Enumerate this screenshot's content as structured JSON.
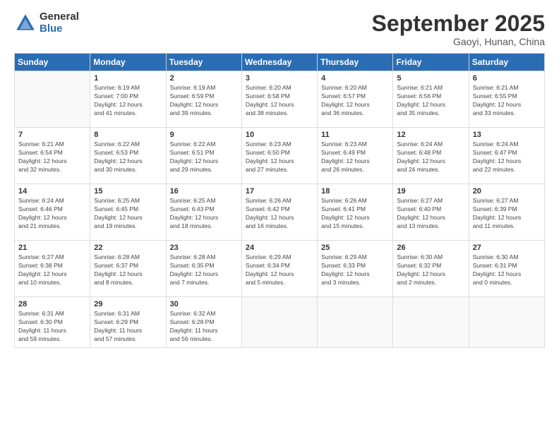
{
  "logo": {
    "general": "General",
    "blue": "Blue"
  },
  "title": "September 2025",
  "subtitle": "Gaoyi, Hunan, China",
  "weekdays": [
    "Sunday",
    "Monday",
    "Tuesday",
    "Wednesday",
    "Thursday",
    "Friday",
    "Saturday"
  ],
  "weeks": [
    [
      {
        "day": "",
        "info": ""
      },
      {
        "day": "1",
        "info": "Sunrise: 6:19 AM\nSunset: 7:00 PM\nDaylight: 12 hours\nand 41 minutes."
      },
      {
        "day": "2",
        "info": "Sunrise: 6:19 AM\nSunset: 6:59 PM\nDaylight: 12 hours\nand 39 minutes."
      },
      {
        "day": "3",
        "info": "Sunrise: 6:20 AM\nSunset: 6:58 PM\nDaylight: 12 hours\nand 38 minutes."
      },
      {
        "day": "4",
        "info": "Sunrise: 6:20 AM\nSunset: 6:57 PM\nDaylight: 12 hours\nand 36 minutes."
      },
      {
        "day": "5",
        "info": "Sunrise: 6:21 AM\nSunset: 6:56 PM\nDaylight: 12 hours\nand 35 minutes."
      },
      {
        "day": "6",
        "info": "Sunrise: 6:21 AM\nSunset: 6:55 PM\nDaylight: 12 hours\nand 33 minutes."
      }
    ],
    [
      {
        "day": "7",
        "info": "Sunrise: 6:21 AM\nSunset: 6:54 PM\nDaylight: 12 hours\nand 32 minutes."
      },
      {
        "day": "8",
        "info": "Sunrise: 6:22 AM\nSunset: 6:53 PM\nDaylight: 12 hours\nand 30 minutes."
      },
      {
        "day": "9",
        "info": "Sunrise: 6:22 AM\nSunset: 6:51 PM\nDaylight: 12 hours\nand 29 minutes."
      },
      {
        "day": "10",
        "info": "Sunrise: 6:23 AM\nSunset: 6:50 PM\nDaylight: 12 hours\nand 27 minutes."
      },
      {
        "day": "11",
        "info": "Sunrise: 6:23 AM\nSunset: 6:49 PM\nDaylight: 12 hours\nand 26 minutes."
      },
      {
        "day": "12",
        "info": "Sunrise: 6:24 AM\nSunset: 6:48 PM\nDaylight: 12 hours\nand 24 minutes."
      },
      {
        "day": "13",
        "info": "Sunrise: 6:24 AM\nSunset: 6:47 PM\nDaylight: 12 hours\nand 22 minutes."
      }
    ],
    [
      {
        "day": "14",
        "info": "Sunrise: 6:24 AM\nSunset: 6:46 PM\nDaylight: 12 hours\nand 21 minutes."
      },
      {
        "day": "15",
        "info": "Sunrise: 6:25 AM\nSunset: 6:45 PM\nDaylight: 12 hours\nand 19 minutes."
      },
      {
        "day": "16",
        "info": "Sunrise: 6:25 AM\nSunset: 6:43 PM\nDaylight: 12 hours\nand 18 minutes."
      },
      {
        "day": "17",
        "info": "Sunrise: 6:26 AM\nSunset: 6:42 PM\nDaylight: 12 hours\nand 16 minutes."
      },
      {
        "day": "18",
        "info": "Sunrise: 6:26 AM\nSunset: 6:41 PM\nDaylight: 12 hours\nand 15 minutes."
      },
      {
        "day": "19",
        "info": "Sunrise: 6:27 AM\nSunset: 6:40 PM\nDaylight: 12 hours\nand 13 minutes."
      },
      {
        "day": "20",
        "info": "Sunrise: 6:27 AM\nSunset: 6:39 PM\nDaylight: 12 hours\nand 11 minutes."
      }
    ],
    [
      {
        "day": "21",
        "info": "Sunrise: 6:27 AM\nSunset: 6:38 PM\nDaylight: 12 hours\nand 10 minutes."
      },
      {
        "day": "22",
        "info": "Sunrise: 6:28 AM\nSunset: 6:37 PM\nDaylight: 12 hours\nand 8 minutes."
      },
      {
        "day": "23",
        "info": "Sunrise: 6:28 AM\nSunset: 6:35 PM\nDaylight: 12 hours\nand 7 minutes."
      },
      {
        "day": "24",
        "info": "Sunrise: 6:29 AM\nSunset: 6:34 PM\nDaylight: 12 hours\nand 5 minutes."
      },
      {
        "day": "25",
        "info": "Sunrise: 6:29 AM\nSunset: 6:33 PM\nDaylight: 12 hours\nand 3 minutes."
      },
      {
        "day": "26",
        "info": "Sunrise: 6:30 AM\nSunset: 6:32 PM\nDaylight: 12 hours\nand 2 minutes."
      },
      {
        "day": "27",
        "info": "Sunrise: 6:30 AM\nSunset: 6:31 PM\nDaylight: 12 hours\nand 0 minutes."
      }
    ],
    [
      {
        "day": "28",
        "info": "Sunrise: 6:31 AM\nSunset: 6:30 PM\nDaylight: 11 hours\nand 59 minutes."
      },
      {
        "day": "29",
        "info": "Sunrise: 6:31 AM\nSunset: 6:29 PM\nDaylight: 11 hours\nand 57 minutes."
      },
      {
        "day": "30",
        "info": "Sunrise: 6:32 AM\nSunset: 6:28 PM\nDaylight: 11 hours\nand 56 minutes."
      },
      {
        "day": "",
        "info": ""
      },
      {
        "day": "",
        "info": ""
      },
      {
        "day": "",
        "info": ""
      },
      {
        "day": "",
        "info": ""
      }
    ]
  ]
}
